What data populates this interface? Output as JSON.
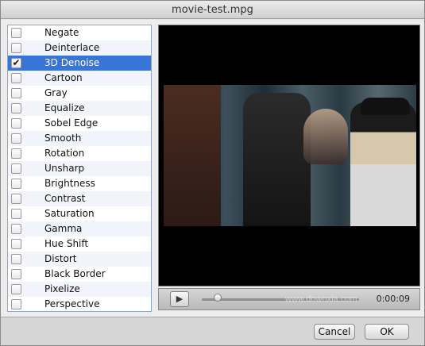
{
  "window": {
    "title": "movie-test.mpg"
  },
  "filters": [
    {
      "label": "Negate",
      "checked": false
    },
    {
      "label": "Deinterlace",
      "checked": false
    },
    {
      "label": "3D Denoise",
      "checked": true
    },
    {
      "label": "Cartoon",
      "checked": false
    },
    {
      "label": "Gray",
      "checked": false
    },
    {
      "label": "Equalize",
      "checked": false
    },
    {
      "label": "Sobel Edge",
      "checked": false
    },
    {
      "label": "Smooth",
      "checked": false
    },
    {
      "label": "Rotation",
      "checked": false
    },
    {
      "label": "Unsharp",
      "checked": false
    },
    {
      "label": "Brightness",
      "checked": false
    },
    {
      "label": "Contrast",
      "checked": false
    },
    {
      "label": "Saturation",
      "checked": false
    },
    {
      "label": "Gamma",
      "checked": false
    },
    {
      "label": "Hue Shift",
      "checked": false
    },
    {
      "label": "Distort",
      "checked": false
    },
    {
      "label": "Black Border",
      "checked": false
    },
    {
      "label": "Pixelize",
      "checked": false
    },
    {
      "label": "Perspective",
      "checked": false
    }
  ],
  "player": {
    "time": "0:00:09",
    "progress": 0.1,
    "play_icon": "play-icon"
  },
  "buttons": {
    "cancel": "Cancel",
    "ok": "OK"
  },
  "watermark": {
    "text": "www.downxia.com"
  },
  "colors": {
    "selection": "#3875d7"
  }
}
